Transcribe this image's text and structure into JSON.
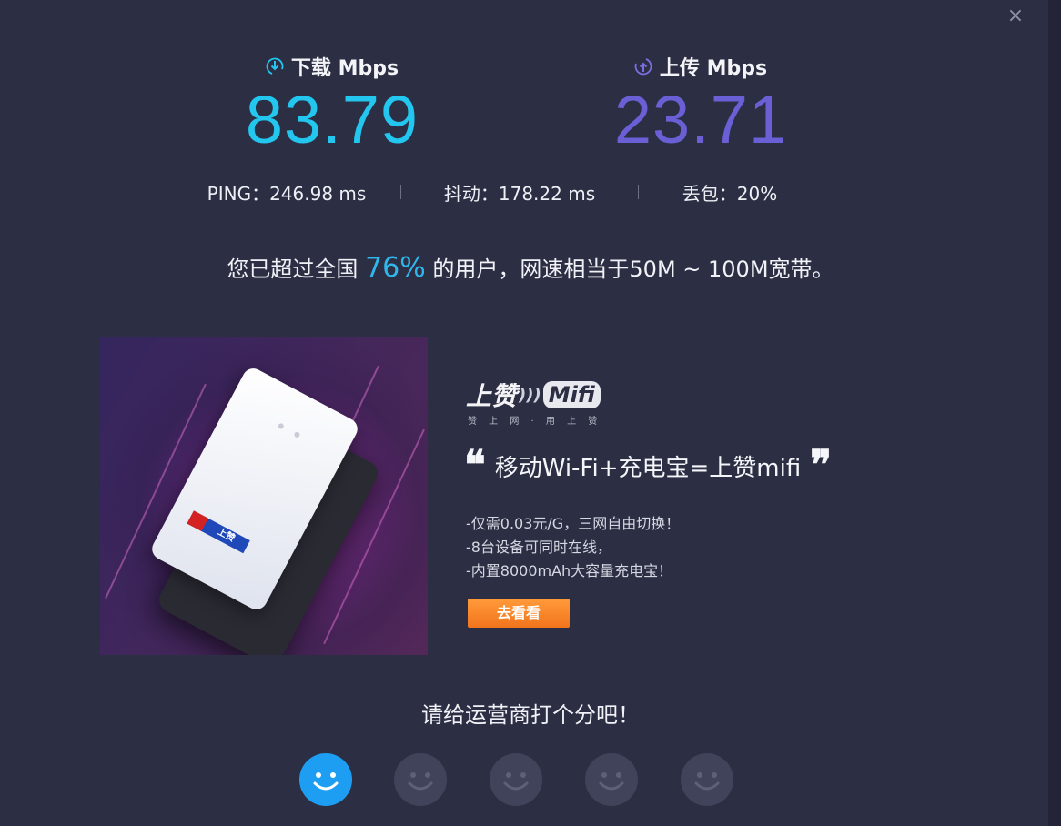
{
  "download": {
    "label": "下载 Mbps",
    "value": "83.79",
    "icon": "download-icon",
    "color": "#22c6ee"
  },
  "upload": {
    "label": "上传 Mbps",
    "value": "23.71",
    "icon": "upload-icon",
    "color": "#6b5fd6"
  },
  "stats": {
    "ping": "PING：246.98 ms",
    "jitter": "抖动：178.22 ms",
    "loss": "丢包：20%"
  },
  "summary": {
    "prefix": "您已超过全国",
    "percent": "76%",
    "suffix": "的用户，网速相当于50M ~ 100M宽带。"
  },
  "ad": {
    "brand_name": "上赞",
    "brand_tag": "Mifi",
    "brand_sub": "赞 上 网 · 用 上 赞",
    "device_logo": "上赞",
    "open_quote": "❝",
    "headline": "移动Wi-Fi+充电宝=上赞mifi",
    "close_quote": "❞",
    "features": [
      "-仅需0.03元/G，三网自由切换！",
      "-8台设备可同时在线，",
      "-内置8000mAh大容量充电宝！"
    ],
    "cta": "去看看"
  },
  "rating": {
    "title": "请给运营商打个分吧！",
    "faces": 5,
    "selected": 1
  },
  "close_icon": "×"
}
